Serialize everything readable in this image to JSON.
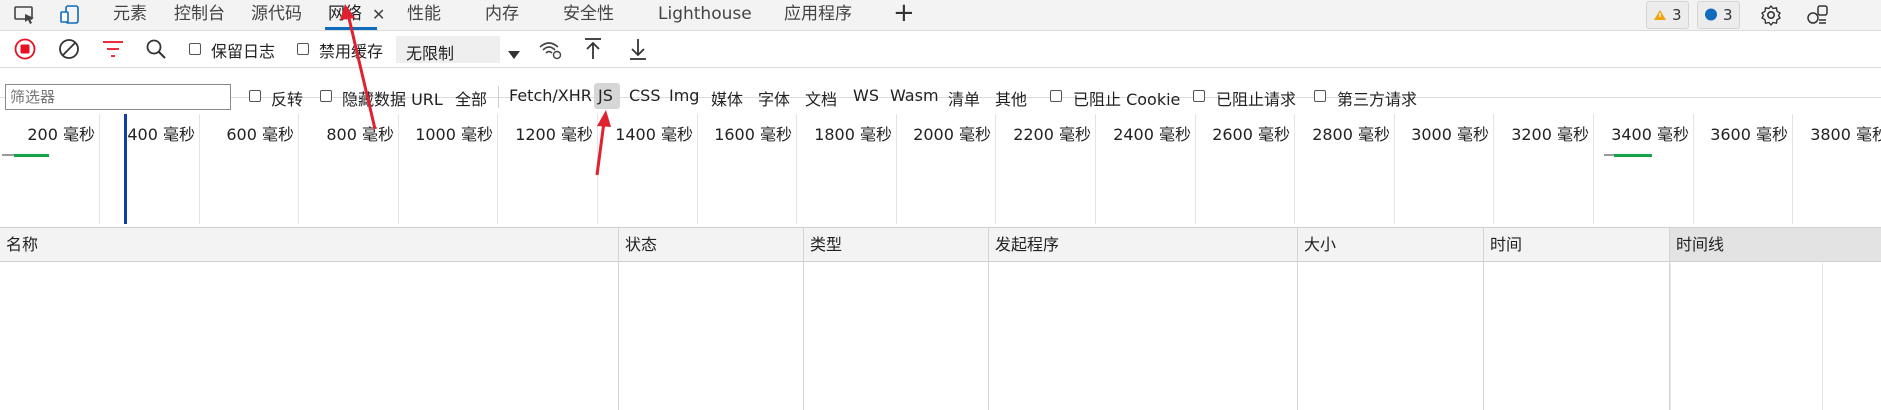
{
  "tabs": [
    {
      "label": "元素"
    },
    {
      "label": "控制台"
    },
    {
      "label": "源代码"
    },
    {
      "label": "网络"
    },
    {
      "label": "性能"
    },
    {
      "label": "内存"
    },
    {
      "label": "安全性"
    },
    {
      "label": "Lighthouse"
    },
    {
      "label": "应用程序"
    }
  ],
  "active_tab_close": "✕",
  "add_tab": "+",
  "issues": {
    "warnings": "3",
    "messages": "3"
  },
  "toolbar": {
    "preserve_log": "保留日志",
    "disable_cache": "禁用缓存",
    "throttling": "无限制"
  },
  "filter": {
    "placeholder": "筛选器",
    "invert": "反转",
    "hide_data_urls": "隐藏数据 URL",
    "all": "全部",
    "types": [
      "Fetch/XHR",
      "JS",
      "CSS",
      "Img",
      "媒体",
      "字体",
      "文档",
      "WS",
      "Wasm",
      "清单",
      "其他"
    ],
    "blocked_cookies": "已阻止 Cookie",
    "blocked_requests": "已阻止请求",
    "third_party": "第三方请求"
  },
  "overview": {
    "ticks": [
      "200 毫秒",
      "400 毫秒",
      "600 毫秒",
      "800 毫秒",
      "1000 毫秒",
      "1200 毫秒",
      "1400 毫秒",
      "1600 毫秒",
      "1800 毫秒",
      "2000 毫秒",
      "2200 毫秒",
      "2400 毫秒",
      "2600 毫秒",
      "2800 毫秒",
      "3000 毫秒",
      "3200 毫秒",
      "3400 毫秒",
      "3600 毫秒",
      "3800 毫秒"
    ]
  },
  "table": {
    "columns": [
      "名称",
      "状态",
      "类型",
      "发起程序",
      "大小",
      "时间",
      "时间线"
    ]
  },
  "colors": {
    "accent": "#0f6cbd",
    "record": "#e81123",
    "annotation": "#e0212f",
    "waterfall_green": "#16a34a"
  }
}
